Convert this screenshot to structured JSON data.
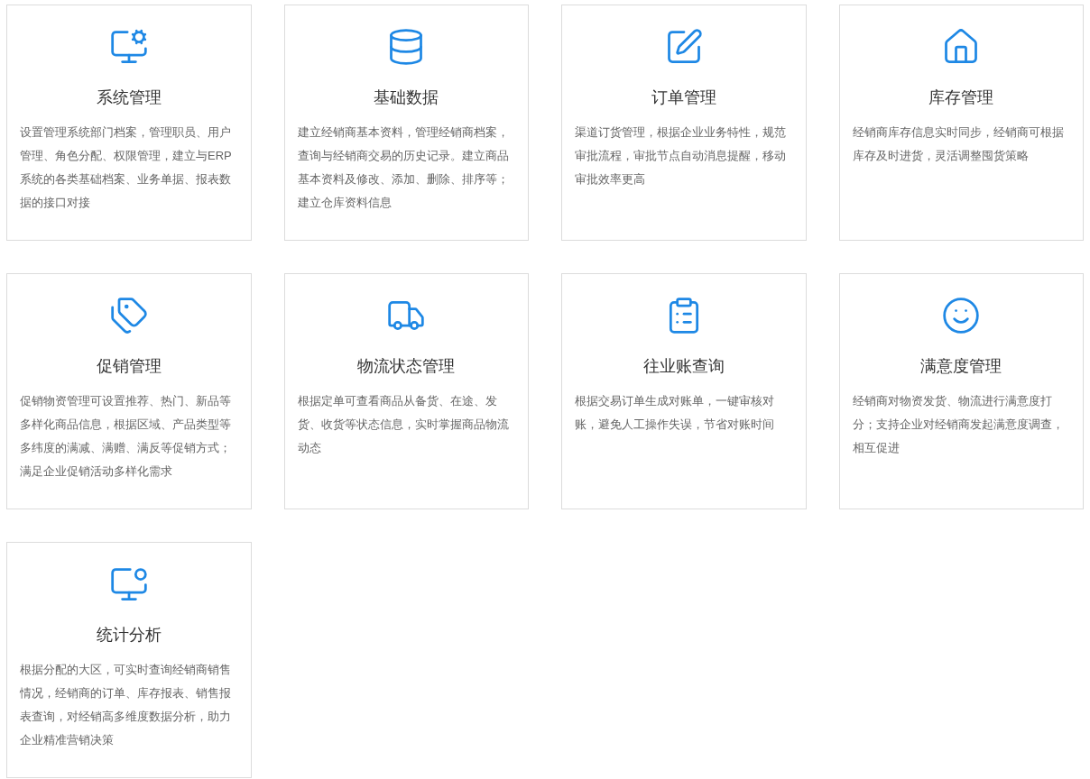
{
  "cards": [
    {
      "title": "系统管理",
      "description": "设置管理系统部门档案，管理职员、用户管理、角色分配、权限管理，建立与ERP系统的各类基础档案、业务单据、报表数据的接口对接"
    },
    {
      "title": "基础数据",
      "description": "建立经销商基本资料，管理经销商档案，查询与经销商交易的历史记录。建立商品基本资料及修改、添加、删除、排序等；建立仓库资料信息"
    },
    {
      "title": "订单管理",
      "description": "渠道订货管理，根据企业业务特性，规范审批流程，审批节点自动消息提醒，移动审批效率更高"
    },
    {
      "title": "库存管理",
      "description": "经销商库存信息实时同步，经销商可根据库存及时进货，灵活调整囤货策略"
    },
    {
      "title": "促销管理",
      "description": "促销物资管理可设置推荐、热门、新品等多样化商品信息，根据区域、产品类型等多纬度的满减、满赠、满反等促销方式；满足企业促销活动多样化需求"
    },
    {
      "title": "物流状态管理",
      "description": "根据定单可查看商品从备货、在途、发货、收货等状态信息，实时掌握商品物流动态"
    },
    {
      "title": "往业账查询",
      "description": "根据交易订单生成对账单，一键审核对账，避免人工操作失误，节省对账时间"
    },
    {
      "title": "满意度管理",
      "description": "经销商对物资发货、物流进行满意度打分；支持企业对经销商发起满意度调查，相互促进"
    },
    {
      "title": "统计分析",
      "description": "根据分配的大区，可实时查询经销商销售情况，经销商的订单、库存报表、销售报表查询，对经销高多维度数据分析，助力企业精准营销决策"
    }
  ]
}
